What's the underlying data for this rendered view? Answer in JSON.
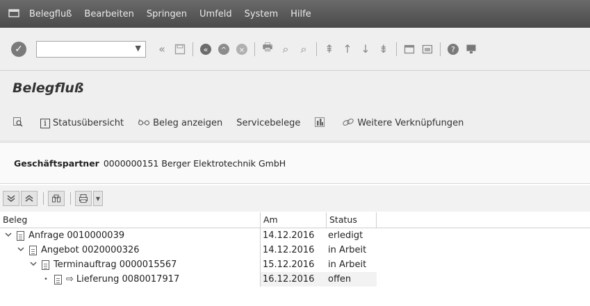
{
  "menubar": {
    "items": [
      "Belegfluß",
      "Bearbeiten",
      "Springen",
      "Umfeld",
      "System",
      "Hilfe"
    ]
  },
  "toolbar": {
    "command_value": "",
    "icons": [
      "check-icon",
      "back-icon",
      "save-icon",
      "nav-back-icon",
      "exit-icon",
      "cancel-icon",
      "print-icon",
      "find-icon",
      "find-next-icon",
      "first-page-icon",
      "prev-page-icon",
      "next-page-icon",
      "last-page-icon",
      "create-session-icon",
      "shortcut-icon",
      "help-icon",
      "layout-icon"
    ]
  },
  "title": "Belegfluß",
  "appbar": {
    "status_overview": "Statusübersicht",
    "show_document": "Beleg anzeigen",
    "service_documents": "Servicebelege",
    "more_links": "Weitere Verknüpfungen"
  },
  "business_partner": {
    "label": "Geschäftspartner",
    "value": "0000000151 Berger Elektrotechnik GmbH"
  },
  "tree": {
    "columns": [
      "Beleg",
      "Am",
      "Status",
      ""
    ],
    "rows": [
      {
        "label": "Anfrage 0010000039",
        "date": "14.12.2016",
        "status": "erledigt",
        "level": 0
      },
      {
        "label": "Angebot 0020000326",
        "date": "14.12.2016",
        "status": "in Arbeit",
        "level": 1
      },
      {
        "label": "Terminauftrag 0000015567",
        "date": "15.12.2016",
        "status": "in Arbeit",
        "level": 2
      },
      {
        "label": "Lieferung 0080017917",
        "date": "16.12.2016",
        "status": "offen",
        "level": 3
      }
    ]
  }
}
